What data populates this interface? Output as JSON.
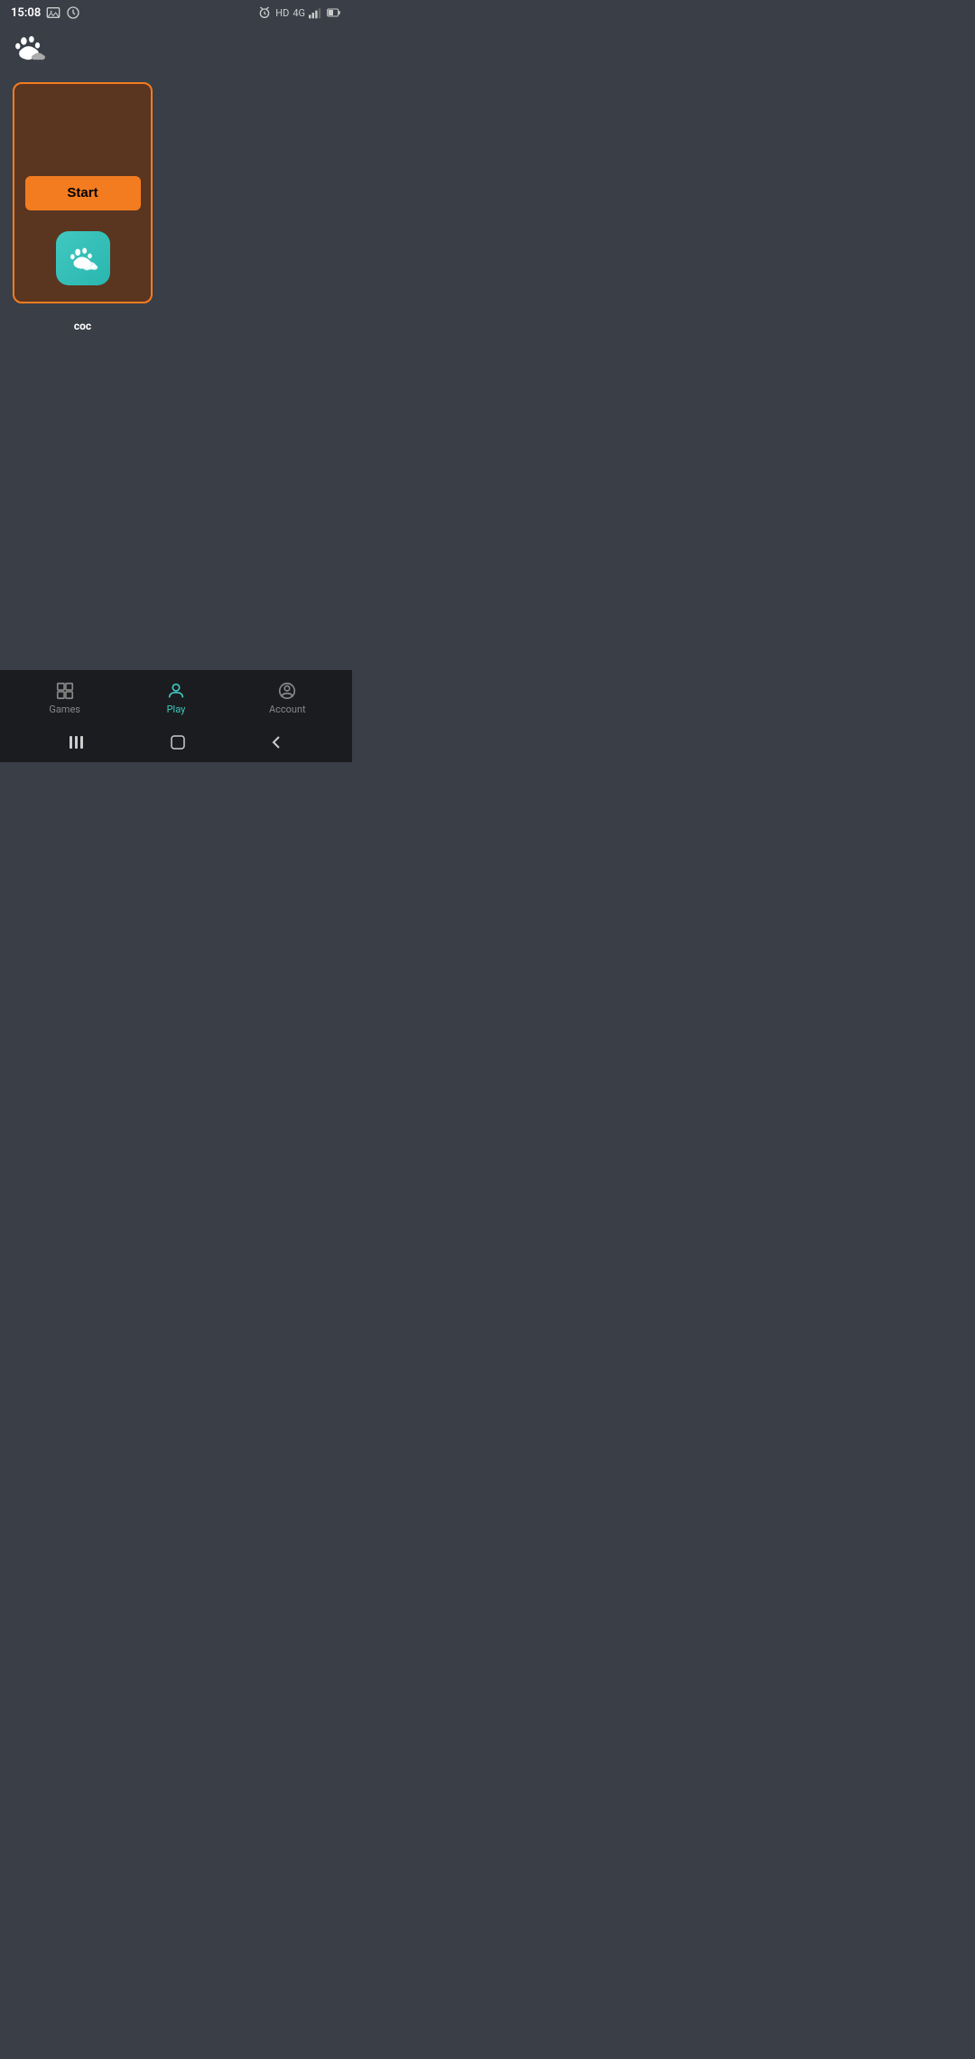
{
  "statusBar": {
    "time": "15:08",
    "icons": {
      "gallery": "🖼",
      "timer": "⏱",
      "alarm": "⏰",
      "hd": "HD",
      "network": "4G"
    }
  },
  "header": {
    "logo_alt": "paw cloud logo"
  },
  "gameCard": {
    "start_label": "Start",
    "app_name": "coc",
    "app_icon_alt": "coc app icon"
  },
  "bottomNav": {
    "items": [
      {
        "id": "games",
        "label": "Games",
        "active": false
      },
      {
        "id": "play",
        "label": "Play",
        "active": true
      },
      {
        "id": "account",
        "label": "Account",
        "active": false
      }
    ]
  },
  "systemNav": {
    "back_label": "‹",
    "home_label": "○",
    "recents_label": "|||"
  }
}
